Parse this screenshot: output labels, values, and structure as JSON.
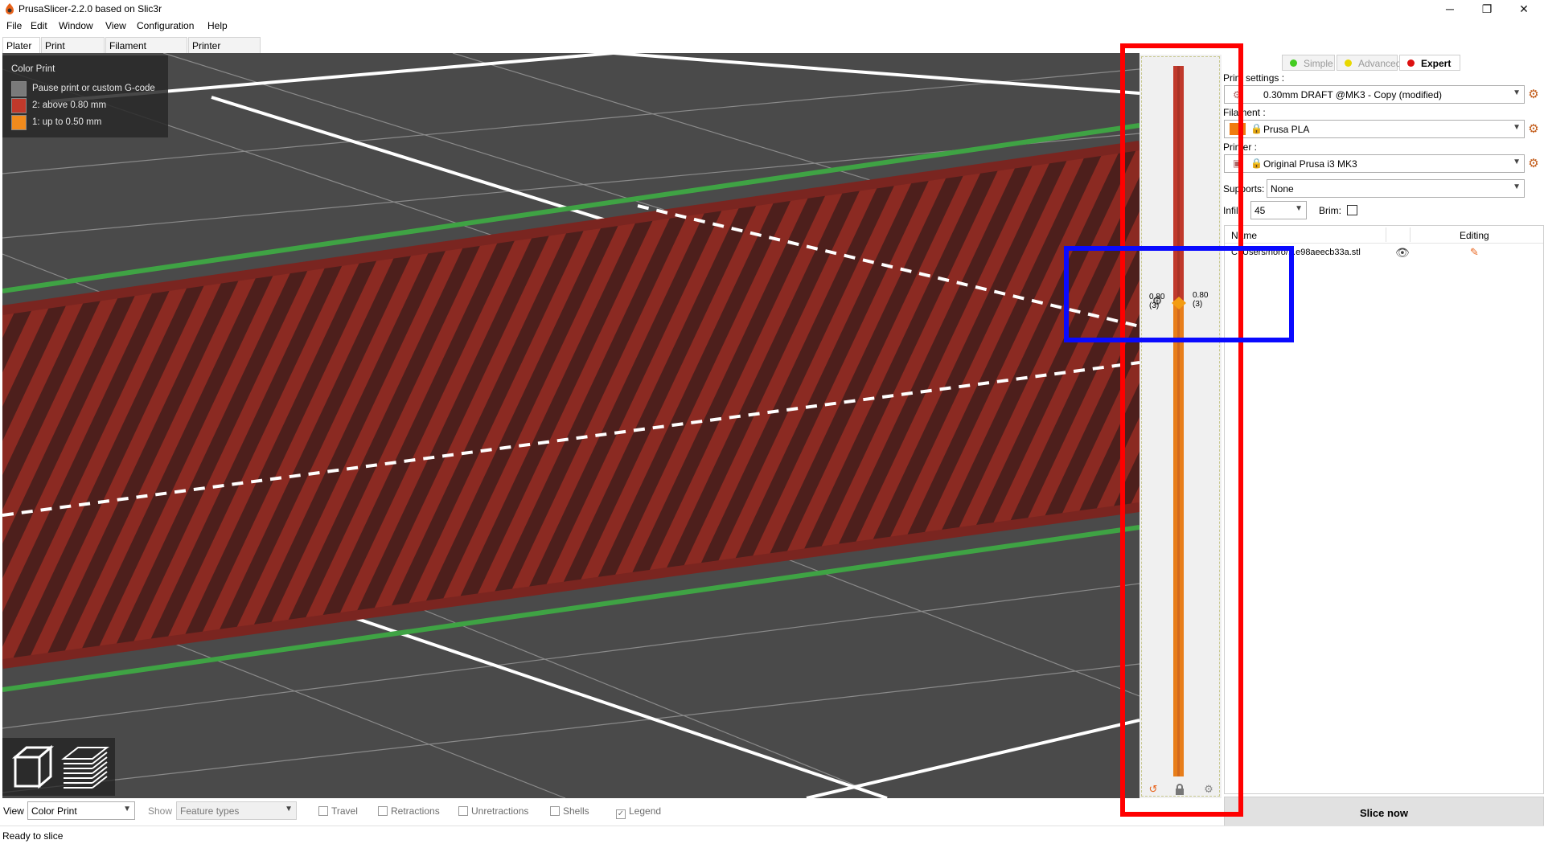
{
  "window": {
    "title": "PrusaSlicer-2.2.0 based on Slic3r",
    "minimize_glyph": "─",
    "restore_glyph": "❐",
    "close_glyph": "✕"
  },
  "menu": [
    "File",
    "Edit",
    "Window",
    "View",
    "Configuration",
    "Help"
  ],
  "tabs": [
    "Plater",
    "Print Settings",
    "Filament Settings",
    "Printer Settings"
  ],
  "legend": {
    "title": "Color Print",
    "items": [
      {
        "label": "Pause print or custom G-code",
        "color": "#7a7a7a"
      },
      {
        "label": "2: above 0.80 mm",
        "color": "#c0392b"
      },
      {
        "label": "1: up to 0.50 mm",
        "color": "#f08a1c"
      }
    ]
  },
  "layer_slider": {
    "upper_value": "0.80",
    "upper_layer": "(3)",
    "lower_value": "0.80",
    "lower_layer": "(3)",
    "upper_color": "#c0392b",
    "lower_color": "#e87e1a"
  },
  "sidebar": {
    "modes": [
      {
        "label": "Simple",
        "color": "#44cc22",
        "active": false
      },
      {
        "label": "Advanced",
        "color": "#e8d800",
        "active": false
      },
      {
        "label": "Expert",
        "color": "#dd1111",
        "active": true
      }
    ],
    "print_settings_label": "Print settings :",
    "print_settings_value": "0.30mm DRAFT @MK3 - Copy (modified)",
    "filament_label": "Filament :",
    "filament_value": "Prusa PLA",
    "filament_color": "#f07b10",
    "printer_label": "Printer :",
    "printer_value": "Original Prusa i3 MK3",
    "supports_label": "Supports:",
    "supports_value": "None",
    "infill_label": "Infill:",
    "infill_value": "45",
    "brim_label": "Brim:",
    "object_list": {
      "columns": [
        "Name",
        "Editing"
      ],
      "rows": [
        {
          "name": "C:/Users/horo/...e98aeecb33a.stl"
        }
      ]
    },
    "slice_button": "Slice now"
  },
  "bottom_bar": {
    "view_label": "View",
    "view_value": "Color Print",
    "show_label": "Show",
    "show_value": "Feature types",
    "checkboxes": [
      {
        "label": "Travel",
        "checked": false
      },
      {
        "label": "Retractions",
        "checked": false
      },
      {
        "label": "Unretractions",
        "checked": false
      },
      {
        "label": "Shells",
        "checked": false
      },
      {
        "label": "Legend",
        "checked": true
      }
    ]
  },
  "status": "Ready to slice"
}
